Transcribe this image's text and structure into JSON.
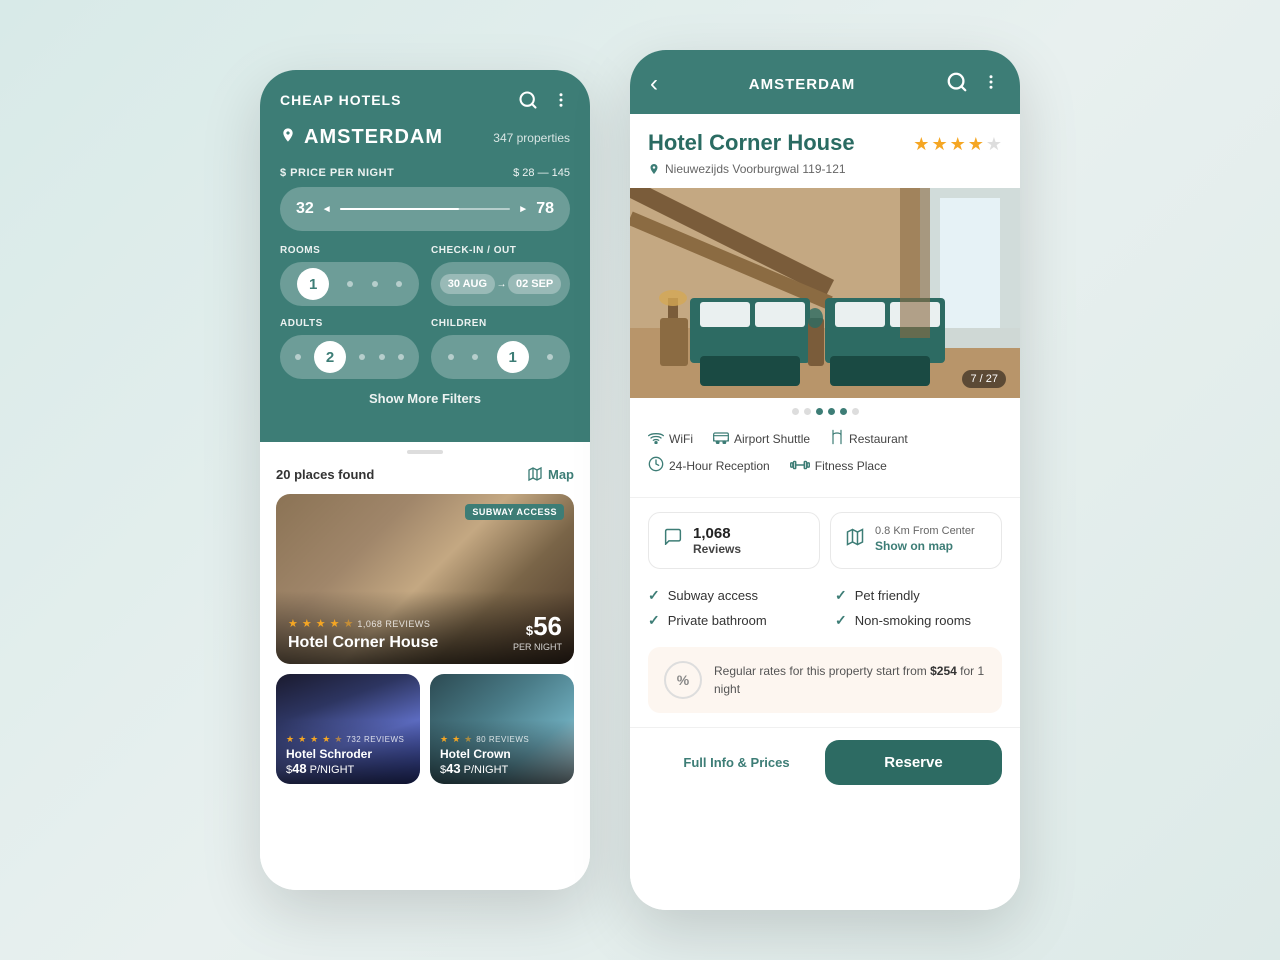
{
  "left_phone": {
    "header": {
      "title": "CHEAP HOTELS",
      "search_icon": "🔍",
      "menu_icon": "⋮"
    },
    "location": {
      "pin_icon": "📍",
      "name": "AMSTERDAM",
      "properties_count": "347 properties"
    },
    "price_filter": {
      "label": "$ PRICE PER NIGHT",
      "range": "$ 28 — 145",
      "min": "32",
      "max": "78"
    },
    "rooms_filter": {
      "label": "ROOMS",
      "value": "1"
    },
    "checkin_filter": {
      "label": "CHECK-IN / OUT",
      "checkin": "30 AUG",
      "checkout": "02 SEP"
    },
    "adults_filter": {
      "label": "ADULTS",
      "value": "2"
    },
    "children_filter": {
      "label": "CHILDREN",
      "value": "1"
    },
    "show_more": "Show More Filters",
    "results": {
      "count": "20",
      "label": "places found",
      "map_label": "Map"
    },
    "hotels": [
      {
        "name": "Hotel Corner House",
        "stars": 4,
        "reviews_count": "1,068",
        "reviews_label": "REVIEWS",
        "price": "56",
        "per_night": "PER NIGHT",
        "badge": "SUBWAY ACCESS"
      },
      {
        "name": "Hotel Schroder",
        "stars": 4,
        "reviews_count": "732",
        "reviews_label": "REVIEWS",
        "price": "48",
        "per_night": "P/NIGHT"
      },
      {
        "name": "Hotel Crown",
        "stars": 2,
        "reviews_count": "80",
        "reviews_label": "REVIEWS",
        "price": "43",
        "per_night": "P/NIGHT"
      }
    ]
  },
  "right_phone": {
    "header": {
      "back_icon": "‹",
      "city": "AMSTERDAM",
      "search_icon": "🔍",
      "menu_icon": "⋮"
    },
    "hotel": {
      "name": "Hotel Corner House",
      "stars": 4,
      "address": "Nieuwezijds Voorburgwal 119-121",
      "img_counter": "7 / 27",
      "img_dots": [
        false,
        false,
        true,
        true,
        true,
        false
      ],
      "amenities": [
        {
          "icon": "wifi",
          "label": "WiFi"
        },
        {
          "icon": "shuttle",
          "label": "Airport Shuttle"
        },
        {
          "icon": "restaurant",
          "label": "Restaurant"
        },
        {
          "icon": "clock",
          "label": "24-Hour Reception"
        },
        {
          "icon": "fitness",
          "label": "Fitness Place"
        }
      ],
      "reviews_count": "1,068",
      "reviews_label": "Reviews",
      "distance": "0.8 Km From Center",
      "map_label": "Show on map",
      "features": [
        "Subway access",
        "Pet friendly",
        "Private bathroom",
        "Non-smoking rooms"
      ],
      "promo_text": "Regular rates for this property start from",
      "promo_price": "$254",
      "promo_duration": "for 1 night",
      "full_info_label": "Full Info & Prices",
      "reserve_label": "Reserve"
    }
  }
}
